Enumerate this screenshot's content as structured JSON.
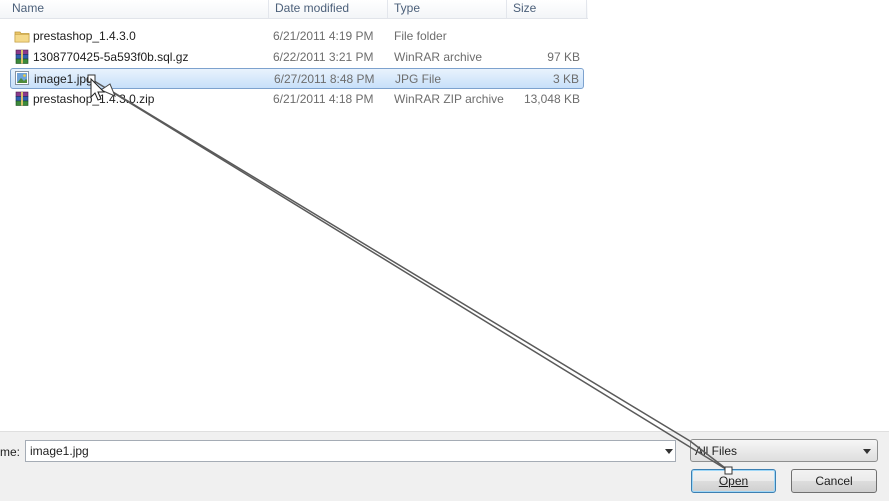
{
  "columns": {
    "name": "Name",
    "date": "Date modified",
    "type": "Type",
    "size": "Size"
  },
  "files": [
    {
      "name": "prestashop_1.4.3.0",
      "date": "6/21/2011 4:19 PM",
      "type": "File folder",
      "size": "",
      "icon": "folder-icon",
      "selected": false
    },
    {
      "name": "1308770425-5a593f0b.sql.gz",
      "date": "6/22/2011 3:21 PM",
      "type": "WinRAR archive",
      "size": "97 KB",
      "icon": "winrar-archive-icon",
      "selected": false
    },
    {
      "name": "image1.jpg",
      "date": "6/27/2011 8:48 PM",
      "type": "JPG File",
      "size": "3 KB",
      "icon": "jpg-image-icon",
      "selected": true
    },
    {
      "name": "prestashop_1.4.3.0.zip",
      "date": "6/21/2011 4:18 PM",
      "type": "WinRAR ZIP archive",
      "size": "13,048 KB",
      "icon": "winrar-zip-icon",
      "selected": false
    }
  ],
  "filename": {
    "label": "me:",
    "value": "image1.jpg"
  },
  "filter": {
    "value": "All Files"
  },
  "buttons": {
    "open": "Open",
    "cancel": "Cancel"
  },
  "colors": {
    "selection": "#c7e0f9",
    "selection_border": "#7da2ce",
    "header_text": "#4c607a",
    "annotation_line": "#5a5a5a"
  }
}
